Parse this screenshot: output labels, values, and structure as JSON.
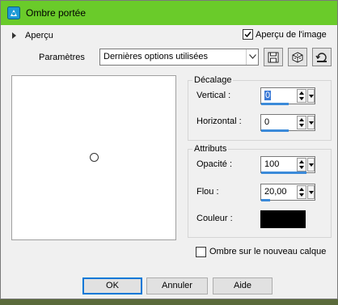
{
  "title": "Ombre portée",
  "preview_section": {
    "label": "Aperçu",
    "image_preview_label": "Aperçu de l'image",
    "image_preview_checked": true
  },
  "params": {
    "label": "Paramètres",
    "selected": "Dernières options utilisées"
  },
  "toolbar": {
    "icons": [
      "save-icon",
      "cube-icon",
      "reset-icon"
    ]
  },
  "offset": {
    "title": "Décalage",
    "vertical_label": "Vertical :",
    "vertical_value": "0",
    "horizontal_label": "Horizontal :",
    "horizontal_value": "0"
  },
  "attributes": {
    "title": "Attributs",
    "opacity_label": "Opacité :",
    "opacity_value": "100",
    "blur_label": "Flou :",
    "blur_value": "20,00",
    "color_label": "Couleur :",
    "color_value": "#000000"
  },
  "new_layer": {
    "label": "Ombre sur le nouveau calque",
    "checked": false
  },
  "buttons": {
    "ok": "OK",
    "cancel": "Annuler",
    "help": "Aide"
  },
  "colors": {
    "titlebar": "#6acb2a",
    "accent": "#3b8ad9",
    "dialog_bg": "#f0f0f0"
  }
}
